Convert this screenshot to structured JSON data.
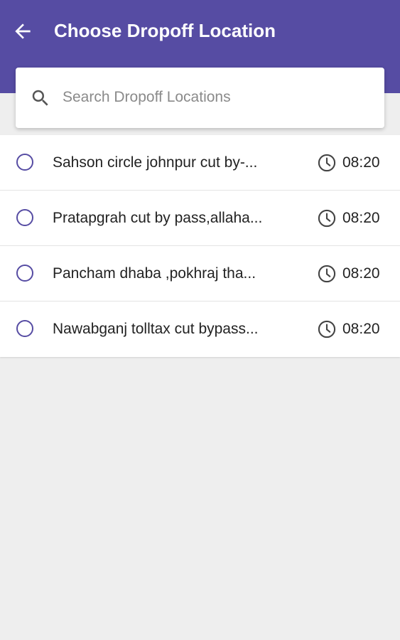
{
  "header": {
    "title": "Choose Dropoff Location",
    "background": "#564ca3"
  },
  "search": {
    "placeholder": "Search Dropoff Locations",
    "value": ""
  },
  "locations": [
    {
      "name": "Sahson circle johnpur cut by-...",
      "time": "08:20",
      "selected": false
    },
    {
      "name": "Pratapgrah cut by pass,allaha...",
      "time": "08:20",
      "selected": false
    },
    {
      "name": "Pancham dhaba ,pokhraj tha...",
      "time": "08:20",
      "selected": false
    },
    {
      "name": "Nawabganj tolltax cut bypass...",
      "time": "08:20",
      "selected": false
    }
  ],
  "icons": {
    "back": "back-arrow-icon",
    "search": "search-icon",
    "radio": "radio-unchecked-icon",
    "time": "clock-icon"
  },
  "colors": {
    "accent": "#564ca3",
    "background": "#eeeeee",
    "text": "#222222"
  }
}
